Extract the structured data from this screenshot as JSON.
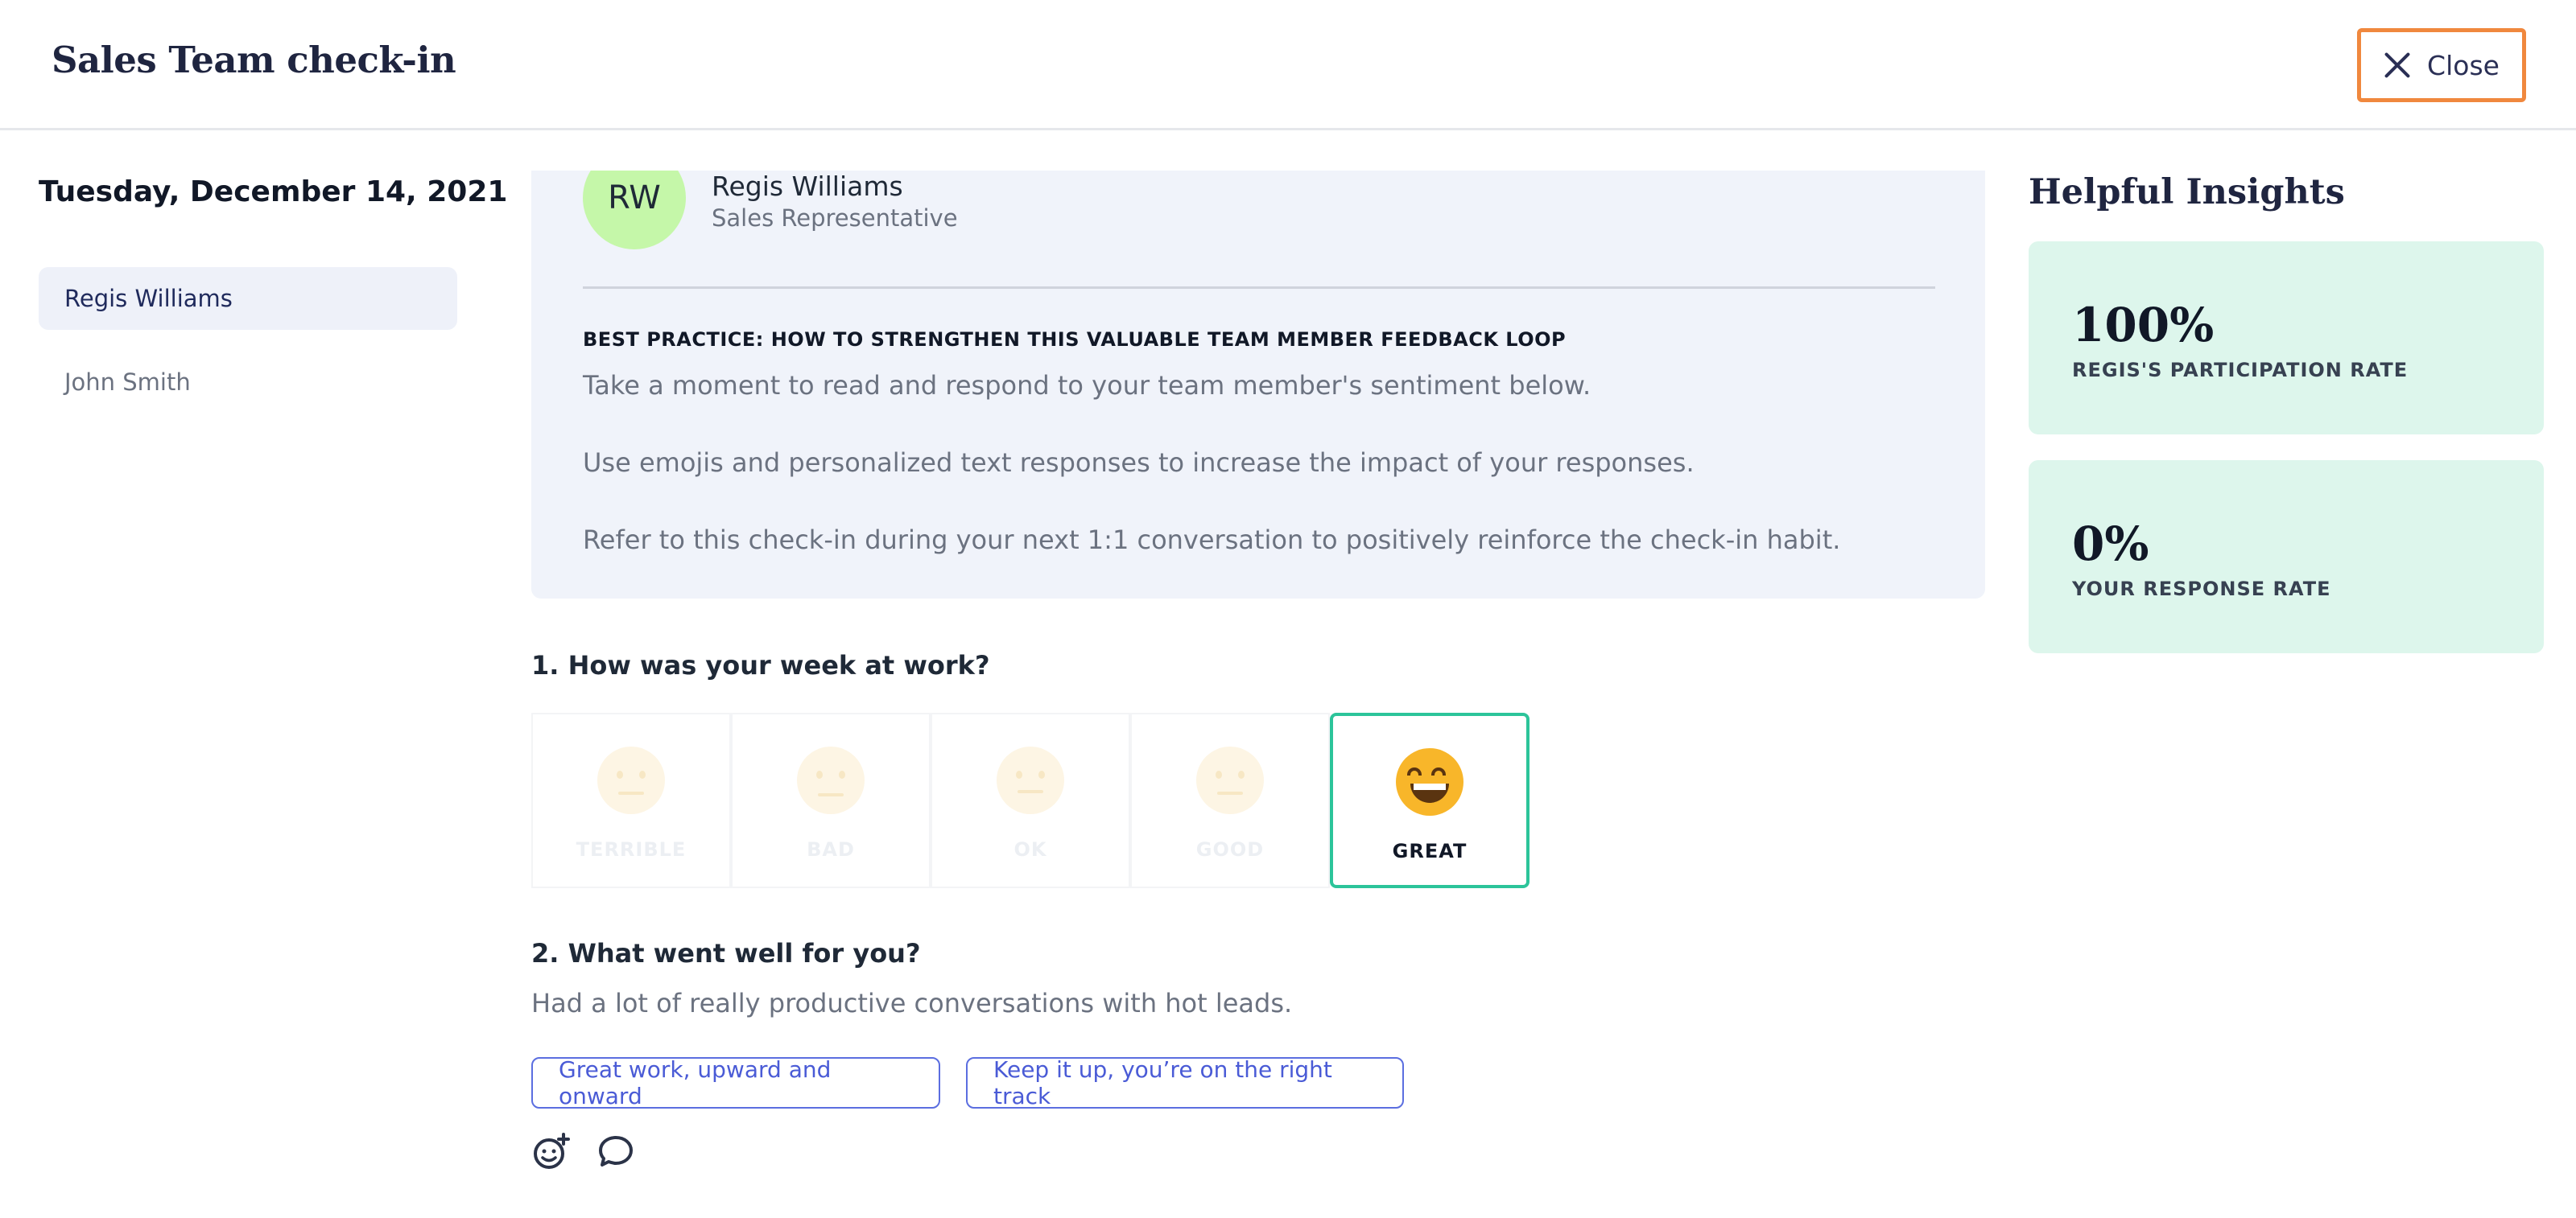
{
  "header": {
    "title": "Sales Team check-in",
    "close_label": "Close"
  },
  "sidebar": {
    "date": "Tuesday, December 14, 2021",
    "members": [
      {
        "name": "Regis Williams",
        "selected": true
      },
      {
        "name": "John Smith",
        "selected": false
      }
    ]
  },
  "card": {
    "avatar_initials": "RW",
    "avatar_color": "#c5f7a9",
    "name": "Regis Williams",
    "role": "Sales Representative",
    "best_practice_title": "BEST PRACTICE: HOW TO STRENGTHEN THIS VALUABLE TEAM MEMBER FEEDBACK LOOP",
    "lines": [
      "Take a moment to read and respond to your team member's sentiment below.",
      "Use emojis and personalized text responses to increase the impact of your responses.",
      "Refer to this check-in during your next 1:1 conversation to positively reinforce the check-in habit."
    ]
  },
  "question1": {
    "title": "1. How was your week at work?",
    "options": [
      {
        "label": "TERRIBLE",
        "icon": "terrible-face-icon",
        "selected": false
      },
      {
        "label": "BAD",
        "icon": "sad-face-icon",
        "selected": false
      },
      {
        "label": "OK",
        "icon": "neutral-face-icon",
        "selected": false
      },
      {
        "label": "GOOD",
        "icon": "smile-face-icon",
        "selected": false
      },
      {
        "label": "GREAT",
        "icon": "grin-face-icon",
        "selected": true
      }
    ],
    "selected_color": "#2cc49a"
  },
  "question2": {
    "title": "2. What went well for you?",
    "answer": "Had a lot of really productive conversations with hot leads.",
    "quick_replies": [
      "Great work, upward and onward",
      "Keep it up, you’re on the right track"
    ],
    "actions": [
      "add-emoji-icon",
      "comment-icon"
    ]
  },
  "insights": {
    "title": "Helpful Insights",
    "cards": [
      {
        "value": "100%",
        "label": "REGIS'S PARTICIPATION RATE"
      },
      {
        "value": "0%",
        "label": "YOUR RESPONSE RATE"
      }
    ],
    "card_color": "#ddf6ec"
  },
  "colors": {
    "accent_close_border": "#f0883e",
    "chip_blue": "#4a5bd6"
  }
}
